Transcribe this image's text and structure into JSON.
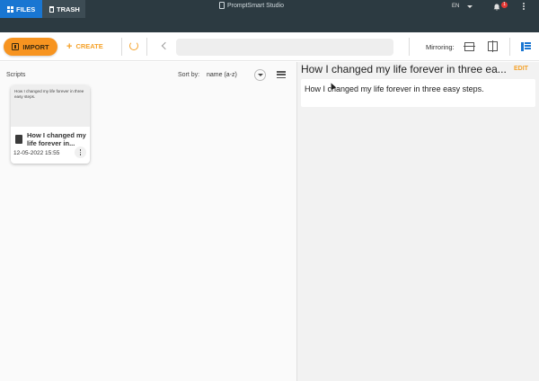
{
  "window": {
    "title": "PromptSmart Studio"
  },
  "titlebar": {
    "language": "EN",
    "notification_count": "1"
  },
  "tabs": [
    {
      "label": "FILES",
      "icon": "grid-icon",
      "active": true
    },
    {
      "label": "TRASH",
      "icon": "trash-icon",
      "active": false
    }
  ],
  "toolbar": {
    "import_label": "IMPORT",
    "create_label": "CREATE",
    "mirroring_label": "Mirroring:",
    "search_value": ""
  },
  "scripts": {
    "label": "Scripts",
    "sort_label": "Sort by:",
    "sort_value": "name (a-z)",
    "items": [
      {
        "preview": "How I changed my life forever in three easy steps.",
        "title": "How I changed my life forever in...",
        "date": "12-05-2022 15:55"
      }
    ]
  },
  "editor": {
    "title": "How I changed my life forever in three ea...",
    "edit_label": "EDIT",
    "content": "How I changed my life forever in three easy steps."
  },
  "colors": {
    "titlebar": "#2c3a41",
    "tab_active": "#1976d2",
    "accent_orange": "#f79420",
    "badge_red": "#e53935"
  }
}
